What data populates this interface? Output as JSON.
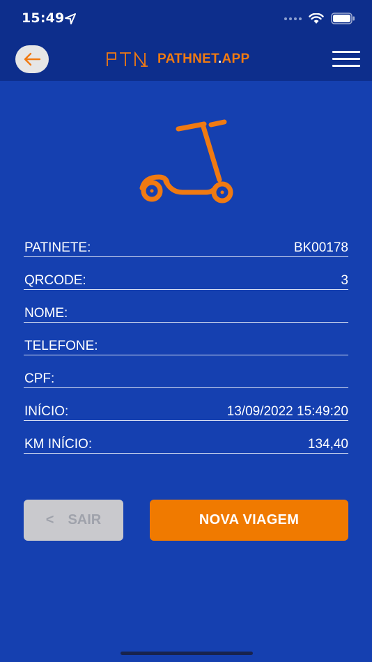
{
  "status": {
    "time": "15:49"
  },
  "header": {
    "brand_mark": "PTN",
    "brand_name": "PATHNET",
    "brand_dot": ".",
    "brand_tld": "APP"
  },
  "fields": [
    {
      "label": "PATINETE:",
      "value": "BK00178"
    },
    {
      "label": "QRCODE:",
      "value": "3"
    },
    {
      "label": "NOME:",
      "value": ""
    },
    {
      "label": "TELEFONE:",
      "value": ""
    },
    {
      "label": "CPF:",
      "value": ""
    },
    {
      "label": "INÍCIO:",
      "value": "13/09/2022 15:49:20"
    },
    {
      "label": "KM INÍCIO:",
      "value": "134,40"
    }
  ],
  "actions": {
    "exit_label": "SAIR",
    "exit_chevron": "<",
    "new_trip_label": "NOVA VIAGEM"
  },
  "colors": {
    "background": "#1540b0",
    "header": "#0d2e8c",
    "accent": "#f07a00",
    "disabled_button": "#c9c9cd"
  },
  "icons": [
    "location-arrow-icon",
    "wifi-icon",
    "battery-icon",
    "arrow-left-icon",
    "menu-icon",
    "scooter-icon"
  ]
}
